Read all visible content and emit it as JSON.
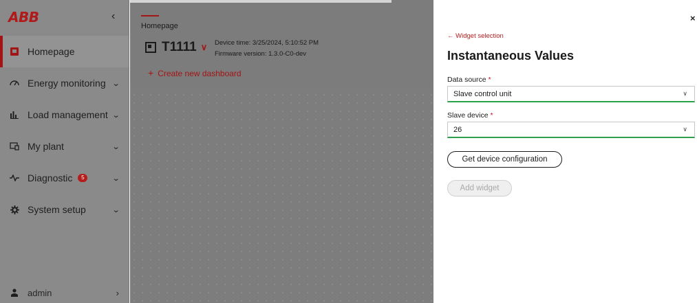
{
  "brand": {
    "logo": "ABB"
  },
  "sidebar": {
    "collapse_glyph": "‹",
    "items": [
      {
        "label": "Homepage",
        "icon": "home-icon"
      },
      {
        "label": "Energy monitoring",
        "icon": "energy-icon"
      },
      {
        "label": "Load management",
        "icon": "load-chart-icon"
      },
      {
        "label": "My plant",
        "icon": "plant-icon"
      },
      {
        "label": "Diagnostic",
        "icon": "pulse-icon",
        "badge": "5"
      },
      {
        "label": "System setup",
        "icon": "gear-icon"
      }
    ],
    "user": "admin"
  },
  "main": {
    "breadcrumb": "Homepage",
    "device_id": "T1111",
    "device_time": "Device time: 3/25/2024, 5:10:52 PM",
    "firmware": "Firmware version: 1.3.0-C0-dev",
    "create_label": "Create new dashboard"
  },
  "panel": {
    "close": "×",
    "back_link": "Widget selection",
    "title": "Instantaneous Values",
    "data_source_label": "Data source",
    "data_source_value": "Slave control unit",
    "slave_device_label": "Slave device",
    "slave_device_value": "26",
    "required_mark": "*",
    "get_config_label": "Get device configuration",
    "add_widget_label": "Add widget"
  },
  "colors": {
    "accent": "#a31515",
    "valid": "#2aa14a"
  }
}
